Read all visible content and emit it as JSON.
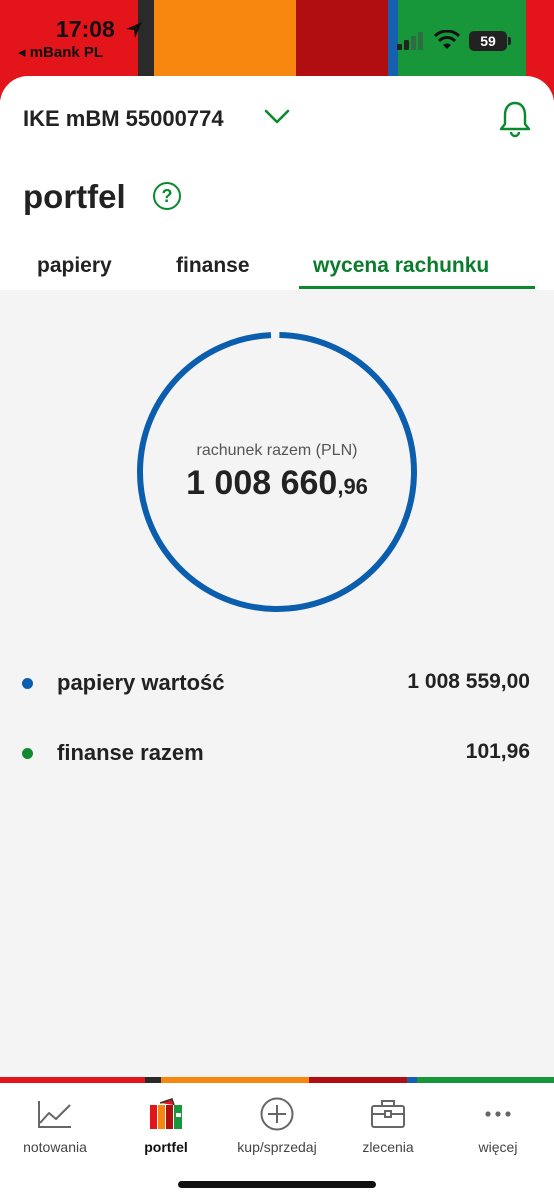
{
  "status": {
    "time": "17:08",
    "back_app": "◂ mBank PL",
    "battery": "59",
    "stripe_colors": [
      "#e3141a",
      "#2a2a2a",
      "#f7870f",
      "#b10e12",
      "#1760b0",
      "#17963a",
      "#e3141a"
    ]
  },
  "header": {
    "account": "IKE mBM 55000774",
    "title": "portfel",
    "help_symbol": "?"
  },
  "tabs": [
    {
      "label": "papiery",
      "active": false
    },
    {
      "label": "finanse",
      "active": false
    },
    {
      "label": "wycena rachunku",
      "active": true
    }
  ],
  "summary": {
    "label": "rachunek razem (PLN)",
    "value_int": "1 008 660",
    "value_dec": ",96",
    "ring_color": "#0b5ead"
  },
  "items": [
    {
      "label": "papiery wartość",
      "value": "1 008 559,00",
      "color": "#0b5ead"
    },
    {
      "label": "finanse razem",
      "value": "101,96",
      "color": "#138a2f"
    }
  ],
  "nav": [
    {
      "label": "notowania",
      "icon": "chart-icon",
      "active": false
    },
    {
      "label": "portfel",
      "icon": "portfolio-icon",
      "active": true
    },
    {
      "label": "kup/sprzedaj",
      "icon": "plus-circle-icon",
      "active": false
    },
    {
      "label": "zlecenia",
      "icon": "briefcase-icon",
      "active": false
    },
    {
      "label": "więcej",
      "icon": "more-icon",
      "active": false
    }
  ],
  "colors": {
    "accent_green": "#0a8a2e",
    "background": "#f4f4f4"
  }
}
